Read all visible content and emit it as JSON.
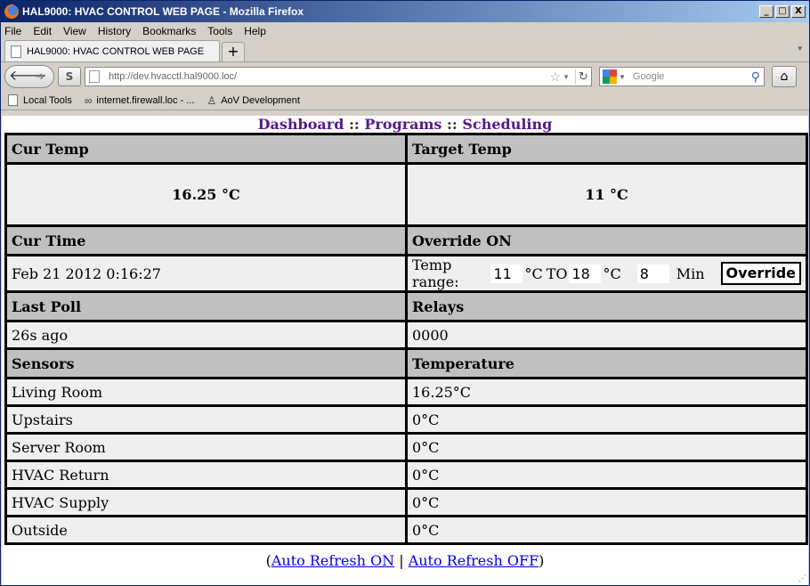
{
  "window": {
    "title": "HAL9000: HVAC CONTROL WEB PAGE - Mozilla Firefox",
    "buttons": [
      "_",
      "□",
      "X"
    ]
  },
  "menu": [
    "File",
    "Edit",
    "View",
    "History",
    "Bookmarks",
    "Tools",
    "Help"
  ],
  "tab": {
    "label": "HAL9000: HVAC CONTROL WEB PAGE",
    "new_tab": "+"
  },
  "nav": {
    "url": "http://dev.hvacctl.hal9000.loc/",
    "search_placeholder": "Google",
    "s_button": "S"
  },
  "bookmarks": [
    "Local Tools",
    "internet.firewall.loc - ...",
    "AoV Development"
  ],
  "page": {
    "nav_links": [
      "Dashboard",
      "Programs",
      "Scheduling"
    ],
    "nav_sep": "::",
    "cur_temp_label": "Cur Temp",
    "target_temp_label": "Target Temp",
    "cur_temp_value": "16.25 °C",
    "target_temp_value": "11 °C",
    "cur_time_label": "Cur Time",
    "override_label": "Override ON",
    "cur_time_value": "Feb 21 2012 0:16:27",
    "temp_range_label": "Temp range:",
    "range_low": "11",
    "unit_c": "°C",
    "to_label": "TO",
    "range_high": "18",
    "minutes": "8",
    "min_label": "Min",
    "override_button": "Override",
    "last_poll_label": "Last Poll",
    "relays_label": "Relays",
    "last_poll_value": "26s ago",
    "relays_value": "0000",
    "sensors_label": "Sensors",
    "temperature_label": "Temperature",
    "sensors": [
      {
        "name": "Living Room",
        "temp": "16.25°C"
      },
      {
        "name": "Upstairs",
        "temp": "0°C"
      },
      {
        "name": "Server Room",
        "temp": "0°C"
      },
      {
        "name": "HVAC Return",
        "temp": "0°C"
      },
      {
        "name": "HVAC Supply",
        "temp": "0°C"
      },
      {
        "name": "Outside",
        "temp": "0°C"
      }
    ],
    "footer": {
      "open": "(",
      "refresh_on": "Auto Refresh ON",
      "sep": "|",
      "refresh_off": "Auto Refresh OFF",
      "close": ")"
    }
  }
}
